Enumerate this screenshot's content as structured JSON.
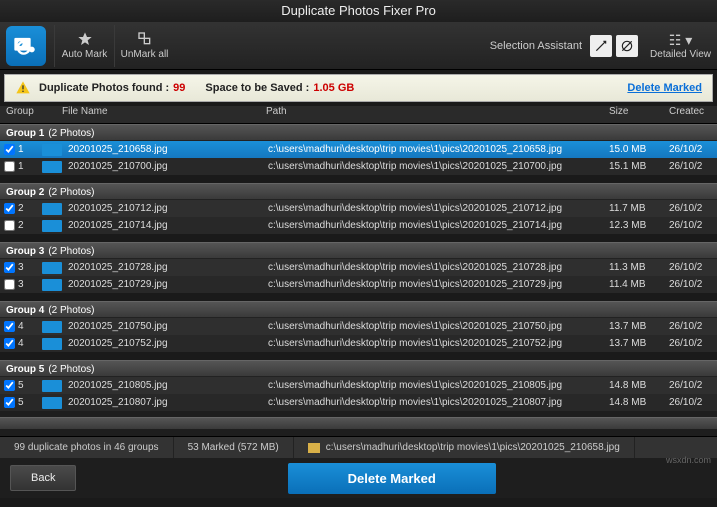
{
  "title": "Duplicate Photos Fixer Pro",
  "toolbar": {
    "automark": "Auto Mark",
    "unmark": "UnMark all",
    "selassist": "Selection Assistant",
    "detailview": "Detailed View"
  },
  "infobar": {
    "found_label": "Duplicate Photos found :",
    "found_count": "99",
    "space_label": "Space to be Saved :",
    "space_value": "1.05 GB",
    "delete_link": "Delete Marked"
  },
  "columns": {
    "group": "Group",
    "name": "File Name",
    "path": "Path",
    "size": "Size",
    "created": "Createc"
  },
  "groups": [
    {
      "title": "Group 1",
      "count": "(2 Photos)",
      "rows": [
        {
          "checked": true,
          "idx": "1",
          "name": "20201025_210658.jpg",
          "path": "c:\\users\\madhuri\\desktop\\trip movies\\1\\pics\\20201025_210658.jpg",
          "size": "15.0 MB",
          "date": "26/10/2",
          "sel": true
        },
        {
          "checked": false,
          "idx": "1",
          "name": "20201025_210700.jpg",
          "path": "c:\\users\\madhuri\\desktop\\trip movies\\1\\pics\\20201025_210700.jpg",
          "size": "15.1 MB",
          "date": "26/10/2"
        }
      ]
    },
    {
      "title": "Group 2",
      "count": "(2 Photos)",
      "rows": [
        {
          "checked": true,
          "idx": "2",
          "name": "20201025_210712.jpg",
          "path": "c:\\users\\madhuri\\desktop\\trip movies\\1\\pics\\20201025_210712.jpg",
          "size": "11.7 MB",
          "date": "26/10/2"
        },
        {
          "checked": false,
          "idx": "2",
          "name": "20201025_210714.jpg",
          "path": "c:\\users\\madhuri\\desktop\\trip movies\\1\\pics\\20201025_210714.jpg",
          "size": "12.3 MB",
          "date": "26/10/2"
        }
      ]
    },
    {
      "title": "Group 3",
      "count": "(2 Photos)",
      "rows": [
        {
          "checked": true,
          "idx": "3",
          "name": "20201025_210728.jpg",
          "path": "c:\\users\\madhuri\\desktop\\trip movies\\1\\pics\\20201025_210728.jpg",
          "size": "11.3 MB",
          "date": "26/10/2"
        },
        {
          "checked": false,
          "idx": "3",
          "name": "20201025_210729.jpg",
          "path": "c:\\users\\madhuri\\desktop\\trip movies\\1\\pics\\20201025_210729.jpg",
          "size": "11.4 MB",
          "date": "26/10/2"
        }
      ]
    },
    {
      "title": "Group 4",
      "count": "(2 Photos)",
      "rows": [
        {
          "checked": true,
          "idx": "4",
          "name": "20201025_210750.jpg",
          "path": "c:\\users\\madhuri\\desktop\\trip movies\\1\\pics\\20201025_210750.jpg",
          "size": "13.7 MB",
          "date": "26/10/2"
        },
        {
          "checked": true,
          "idx": "4",
          "name": "20201025_210752.jpg",
          "path": "c:\\users\\madhuri\\desktop\\trip movies\\1\\pics\\20201025_210752.jpg",
          "size": "13.7 MB",
          "date": "26/10/2"
        }
      ]
    },
    {
      "title": "Group 5",
      "count": "(2 Photos)",
      "rows": [
        {
          "checked": true,
          "idx": "5",
          "name": "20201025_210805.jpg",
          "path": "c:\\users\\madhuri\\desktop\\trip movies\\1\\pics\\20201025_210805.jpg",
          "size": "14.8 MB",
          "date": "26/10/2"
        },
        {
          "checked": true,
          "idx": "5",
          "name": "20201025_210807.jpg",
          "path": "c:\\users\\madhuri\\desktop\\trip movies\\1\\pics\\20201025_210807.jpg",
          "size": "14.8 MB",
          "date": "26/10/2"
        }
      ]
    }
  ],
  "status": {
    "summary": "99 duplicate photos in 46 groups",
    "marked": "53 Marked (572 MB)",
    "path": "c:\\users\\madhuri\\desktop\\trip movies\\1\\pics\\20201025_210658.jpg"
  },
  "buttons": {
    "back": "Back",
    "delete": "Delete Marked"
  },
  "watermark": "wsxdn.com"
}
